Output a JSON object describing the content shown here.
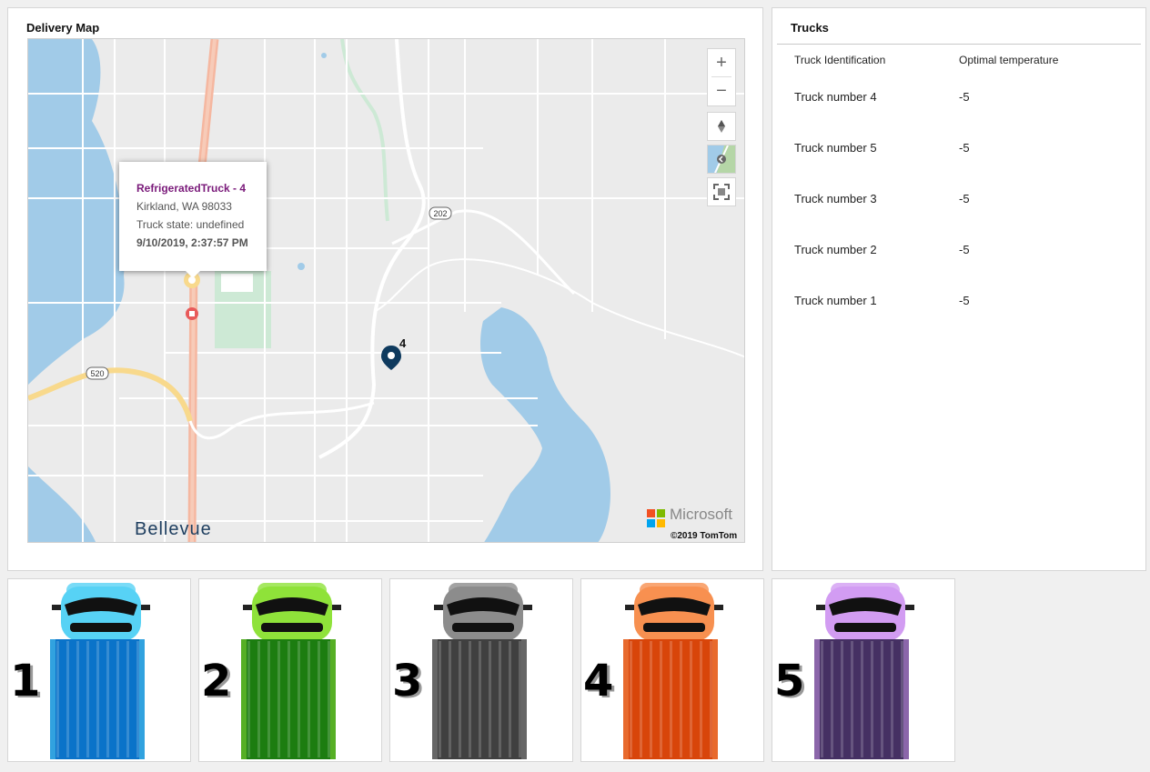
{
  "map_panel": {
    "title": "Delivery Map",
    "place_label": "Bellevue",
    "route_shields": [
      "520",
      "202"
    ],
    "marker_label": "4",
    "popup": {
      "title": "RefrigeratedTruck - 4",
      "address": "Kirkland, WA 98033",
      "state": "Truck state: undefined",
      "timestamp": "9/10/2019, 2:37:57 PM"
    },
    "controls": {
      "zoom_in": "+",
      "zoom_out": "−"
    },
    "attribution": {
      "brand": "Microsoft",
      "copyright": "©2019 TomTom"
    }
  },
  "trucks_panel": {
    "title": "Trucks",
    "columns": [
      "Truck Identification",
      "Optimal temperature"
    ],
    "rows": [
      {
        "id": "Truck number 4",
        "temp": "-5"
      },
      {
        "id": "Truck number 5",
        "temp": "-5"
      },
      {
        "id": "Truck number 3",
        "temp": "-5"
      },
      {
        "id": "Truck number 2",
        "temp": "-5"
      },
      {
        "id": "Truck number 1",
        "temp": "-5"
      }
    ]
  },
  "truck_tiles": [
    {
      "number": "1",
      "cab_color": "#57d2f5",
      "body_color": "#0a73c9"
    },
    {
      "number": "2",
      "cab_color": "#8fe23a",
      "body_color": "#1c7d10"
    },
    {
      "number": "3",
      "cab_color": "#8c8c8c",
      "body_color": "#404040"
    },
    {
      "number": "4",
      "cab_color": "#f79050",
      "body_color": "#d8450a"
    },
    {
      "number": "5",
      "cab_color": "#d29cf2",
      "body_color": "#453063"
    }
  ],
  "colors": {
    "water": "#a1cbe8",
    "park": "#cde9d5",
    "highway": "#f5b7a0",
    "popup_title": "#7a1a7a",
    "marker": "#0e3a5e"
  }
}
